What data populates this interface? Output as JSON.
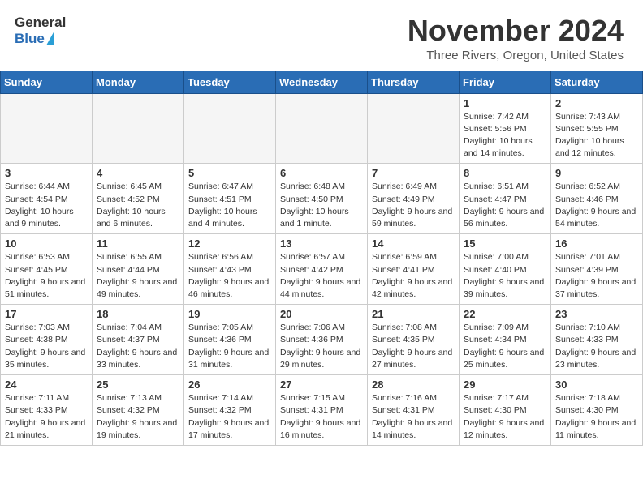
{
  "header": {
    "logo_general": "General",
    "logo_blue": "Blue",
    "title": "November 2024",
    "location": "Three Rivers, Oregon, United States"
  },
  "calendar": {
    "days_of_week": [
      "Sunday",
      "Monday",
      "Tuesday",
      "Wednesday",
      "Thursday",
      "Friday",
      "Saturday"
    ],
    "weeks": [
      [
        {
          "day": "",
          "info": ""
        },
        {
          "day": "",
          "info": ""
        },
        {
          "day": "",
          "info": ""
        },
        {
          "day": "",
          "info": ""
        },
        {
          "day": "",
          "info": ""
        },
        {
          "day": "1",
          "info": "Sunrise: 7:42 AM\nSunset: 5:56 PM\nDaylight: 10 hours and 14 minutes."
        },
        {
          "day": "2",
          "info": "Sunrise: 7:43 AM\nSunset: 5:55 PM\nDaylight: 10 hours and 12 minutes."
        }
      ],
      [
        {
          "day": "3",
          "info": "Sunrise: 6:44 AM\nSunset: 4:54 PM\nDaylight: 10 hours and 9 minutes."
        },
        {
          "day": "4",
          "info": "Sunrise: 6:45 AM\nSunset: 4:52 PM\nDaylight: 10 hours and 6 minutes."
        },
        {
          "day": "5",
          "info": "Sunrise: 6:47 AM\nSunset: 4:51 PM\nDaylight: 10 hours and 4 minutes."
        },
        {
          "day": "6",
          "info": "Sunrise: 6:48 AM\nSunset: 4:50 PM\nDaylight: 10 hours and 1 minute."
        },
        {
          "day": "7",
          "info": "Sunrise: 6:49 AM\nSunset: 4:49 PM\nDaylight: 9 hours and 59 minutes."
        },
        {
          "day": "8",
          "info": "Sunrise: 6:51 AM\nSunset: 4:47 PM\nDaylight: 9 hours and 56 minutes."
        },
        {
          "day": "9",
          "info": "Sunrise: 6:52 AM\nSunset: 4:46 PM\nDaylight: 9 hours and 54 minutes."
        }
      ],
      [
        {
          "day": "10",
          "info": "Sunrise: 6:53 AM\nSunset: 4:45 PM\nDaylight: 9 hours and 51 minutes."
        },
        {
          "day": "11",
          "info": "Sunrise: 6:55 AM\nSunset: 4:44 PM\nDaylight: 9 hours and 49 minutes."
        },
        {
          "day": "12",
          "info": "Sunrise: 6:56 AM\nSunset: 4:43 PM\nDaylight: 9 hours and 46 minutes."
        },
        {
          "day": "13",
          "info": "Sunrise: 6:57 AM\nSunset: 4:42 PM\nDaylight: 9 hours and 44 minutes."
        },
        {
          "day": "14",
          "info": "Sunrise: 6:59 AM\nSunset: 4:41 PM\nDaylight: 9 hours and 42 minutes."
        },
        {
          "day": "15",
          "info": "Sunrise: 7:00 AM\nSunset: 4:40 PM\nDaylight: 9 hours and 39 minutes."
        },
        {
          "day": "16",
          "info": "Sunrise: 7:01 AM\nSunset: 4:39 PM\nDaylight: 9 hours and 37 minutes."
        }
      ],
      [
        {
          "day": "17",
          "info": "Sunrise: 7:03 AM\nSunset: 4:38 PM\nDaylight: 9 hours and 35 minutes."
        },
        {
          "day": "18",
          "info": "Sunrise: 7:04 AM\nSunset: 4:37 PM\nDaylight: 9 hours and 33 minutes."
        },
        {
          "day": "19",
          "info": "Sunrise: 7:05 AM\nSunset: 4:36 PM\nDaylight: 9 hours and 31 minutes."
        },
        {
          "day": "20",
          "info": "Sunrise: 7:06 AM\nSunset: 4:36 PM\nDaylight: 9 hours and 29 minutes."
        },
        {
          "day": "21",
          "info": "Sunrise: 7:08 AM\nSunset: 4:35 PM\nDaylight: 9 hours and 27 minutes."
        },
        {
          "day": "22",
          "info": "Sunrise: 7:09 AM\nSunset: 4:34 PM\nDaylight: 9 hours and 25 minutes."
        },
        {
          "day": "23",
          "info": "Sunrise: 7:10 AM\nSunset: 4:33 PM\nDaylight: 9 hours and 23 minutes."
        }
      ],
      [
        {
          "day": "24",
          "info": "Sunrise: 7:11 AM\nSunset: 4:33 PM\nDaylight: 9 hours and 21 minutes."
        },
        {
          "day": "25",
          "info": "Sunrise: 7:13 AM\nSunset: 4:32 PM\nDaylight: 9 hours and 19 minutes."
        },
        {
          "day": "26",
          "info": "Sunrise: 7:14 AM\nSunset: 4:32 PM\nDaylight: 9 hours and 17 minutes."
        },
        {
          "day": "27",
          "info": "Sunrise: 7:15 AM\nSunset: 4:31 PM\nDaylight: 9 hours and 16 minutes."
        },
        {
          "day": "28",
          "info": "Sunrise: 7:16 AM\nSunset: 4:31 PM\nDaylight: 9 hours and 14 minutes."
        },
        {
          "day": "29",
          "info": "Sunrise: 7:17 AM\nSunset: 4:30 PM\nDaylight: 9 hours and 12 minutes."
        },
        {
          "day": "30",
          "info": "Sunrise: 7:18 AM\nSunset: 4:30 PM\nDaylight: 9 hours and 11 minutes."
        }
      ]
    ]
  }
}
